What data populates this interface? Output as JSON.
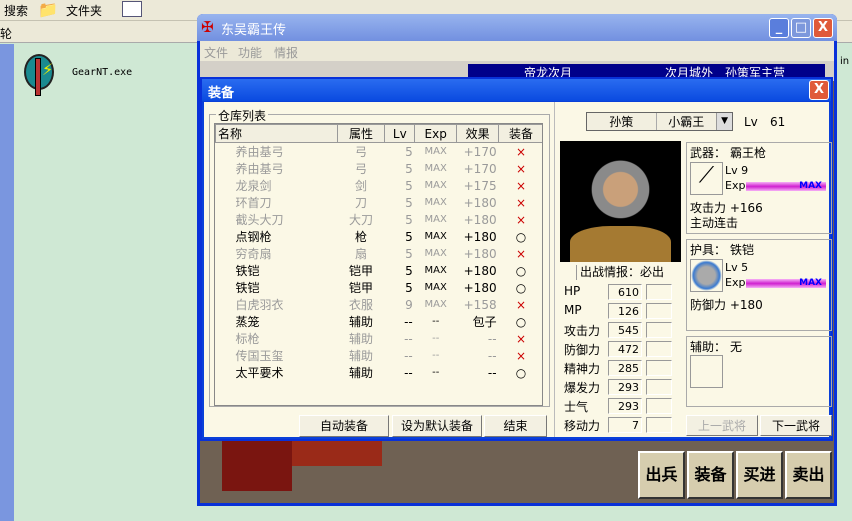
{
  "explorer": {
    "search_label": "搜索",
    "folders_label": "文件夹",
    "address_fragment": "轮",
    "file_name": "GearNT.exe",
    "right_fragment": "in"
  },
  "game": {
    "title": "东吴霸王传",
    "menu": [
      "文件",
      "功能",
      "情报"
    ],
    "banner_left": "帝龙次月",
    "banner_right": "次月城外　孙策军主营",
    "bottom_buttons": [
      "出兵",
      "装备",
      "买进",
      "卖出"
    ]
  },
  "dialog": {
    "title": "装备",
    "close": "X",
    "storage_label": "仓库列表",
    "columns": [
      "名称",
      "属性",
      "Lv",
      "Exp",
      "效果",
      "装备"
    ],
    "rows": [
      {
        "name": "养由基弓",
        "type": "弓",
        "lv": "5",
        "exp": "MAX",
        "effect": "+170",
        "equip": "×",
        "dim": true
      },
      {
        "name": "养由基弓",
        "type": "弓",
        "lv": "5",
        "exp": "MAX",
        "effect": "+170",
        "equip": "×",
        "dim": true
      },
      {
        "name": "龙泉剑",
        "type": "剑",
        "lv": "5",
        "exp": "MAX",
        "effect": "+175",
        "equip": "×",
        "dim": true
      },
      {
        "name": "环首刀",
        "type": "刀",
        "lv": "5",
        "exp": "MAX",
        "effect": "+180",
        "equip": "×",
        "dim": true
      },
      {
        "name": "截头大刀",
        "type": "大刀",
        "lv": "5",
        "exp": "MAX",
        "effect": "+180",
        "equip": "×",
        "dim": true
      },
      {
        "name": "点钢枪",
        "type": "枪",
        "lv": "5",
        "exp": "MAX",
        "effect": "+180",
        "equip": "○",
        "dim": false
      },
      {
        "name": "穷奇扇",
        "type": "扇",
        "lv": "5",
        "exp": "MAX",
        "effect": "+180",
        "equip": "×",
        "dim": true
      },
      {
        "name": "铁铠",
        "type": "铠甲",
        "lv": "5",
        "exp": "MAX",
        "effect": "+180",
        "equip": "○",
        "dim": false
      },
      {
        "name": "铁铠",
        "type": "铠甲",
        "lv": "5",
        "exp": "MAX",
        "effect": "+180",
        "equip": "○",
        "dim": false
      },
      {
        "name": "白虎羽衣",
        "type": "衣服",
        "lv": "9",
        "exp": "MAX",
        "effect": "+158",
        "equip": "×",
        "dim": true
      },
      {
        "name": "蒸笼",
        "type": "辅助",
        "lv": "--",
        "exp": "--",
        "effect": "包子",
        "equip": "○",
        "dim": false
      },
      {
        "name": "标枪",
        "type": "辅助",
        "lv": "--",
        "exp": "--",
        "effect": "--",
        "equip": "×",
        "dim": true
      },
      {
        "name": "传国玉玺",
        "type": "辅助",
        "lv": "--",
        "exp": "--",
        "effect": "--",
        "equip": "×",
        "dim": true
      },
      {
        "name": "太平要术",
        "type": "辅助",
        "lv": "--",
        "exp": "--",
        "effect": "--",
        "equip": "○",
        "dim": false
      }
    ],
    "buttons": {
      "auto": "自动装备",
      "default": "设为默认装备",
      "end": "结束",
      "prev": "上一武将",
      "next": "下一武将"
    },
    "general": {
      "name": "孙策",
      "nickname": "小霸王",
      "lv_label": "Lv",
      "lv": "61",
      "sortie": "出战情报：必出",
      "stats": [
        {
          "label": "HP",
          "value": "610"
        },
        {
          "label": "MP",
          "value": "126"
        },
        {
          "label": "攻击力",
          "value": "545"
        },
        {
          "label": "防御力",
          "value": "472"
        },
        {
          "label": "精神力",
          "value": "285"
        },
        {
          "label": "爆发力",
          "value": "293"
        },
        {
          "label": "士气",
          "value": "293"
        },
        {
          "label": "移动力",
          "value": "7"
        }
      ]
    },
    "weapon": {
      "label": "武器：",
      "name": "霸王枪",
      "lv": "Lv  9",
      "exp_label": "Exp",
      "exp_text": "MAX",
      "exp_fraction": 1.0,
      "effect": "攻击力 +166",
      "skill": "主动连击"
    },
    "armor": {
      "label": "护具：",
      "name": "铁铠",
      "lv": "Lv  5",
      "exp_label": "Exp",
      "exp_text": "MAX",
      "exp_fraction": 1.0,
      "effect": "防御力 +180"
    },
    "aux": {
      "label": "辅助：",
      "name": "无"
    }
  }
}
